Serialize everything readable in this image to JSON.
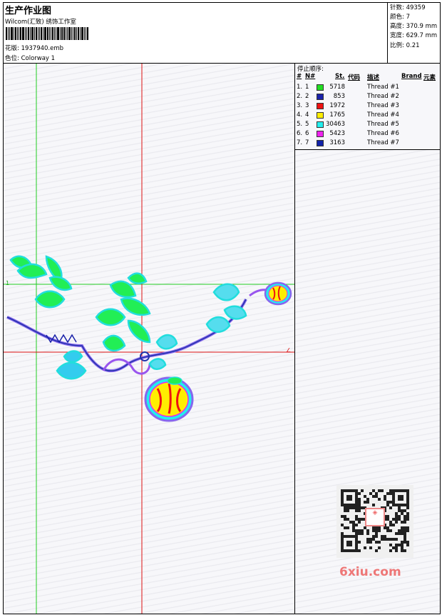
{
  "header": {
    "title": "生产作业图",
    "company": "Wilcom(汇致) 绣饰工作室",
    "design_label": "花版:",
    "design_value": "1937940.emb",
    "colorway_label": "色位:",
    "colorway_value": "Colorway 1"
  },
  "stats": {
    "stitches_label": "针数:",
    "stitches_value": "49359",
    "colors_label": "颜色:",
    "colors_value": "7",
    "height_label": "高度:",
    "height_value": "370.9 mm",
    "width_label": "宽度:",
    "width_value": "629.7 mm",
    "scale_label": "比例:",
    "scale_value": "0.21"
  },
  "thread_table": {
    "title": "停止顺序:",
    "col_hash": "#",
    "col_no": "N#",
    "col_st": "St.",
    "col_code": "代码",
    "col_desc": "描述",
    "col_brand": "Brand",
    "col_element": "元素",
    "rows": [
      {
        "idx": "1.",
        "no": "1",
        "stitches": "5718",
        "desc": "Thread #1",
        "color": "#22dd22"
      },
      {
        "idx": "2.",
        "no": "2",
        "stitches": "853",
        "desc": "Thread #2",
        "color": "#1a22aa"
      },
      {
        "idx": "3.",
        "no": "3",
        "stitches": "1972",
        "desc": "Thread #3",
        "color": "#ee1111"
      },
      {
        "idx": "4.",
        "no": "4",
        "stitches": "1765",
        "desc": "Thread #4",
        "color": "#ffee00"
      },
      {
        "idx": "5.",
        "no": "5",
        "stitches": "30463",
        "desc": "Thread #5",
        "color": "#22eeee"
      },
      {
        "idx": "6.",
        "no": "6",
        "stitches": "5423",
        "desc": "Thread #6",
        "color": "#ee22ee"
      },
      {
        "idx": "7.",
        "no": "7",
        "stitches": "3163",
        "desc": "Thread #7",
        "color": "#1122aa"
      }
    ]
  },
  "watermark": {
    "text": "6xiu.com"
  }
}
